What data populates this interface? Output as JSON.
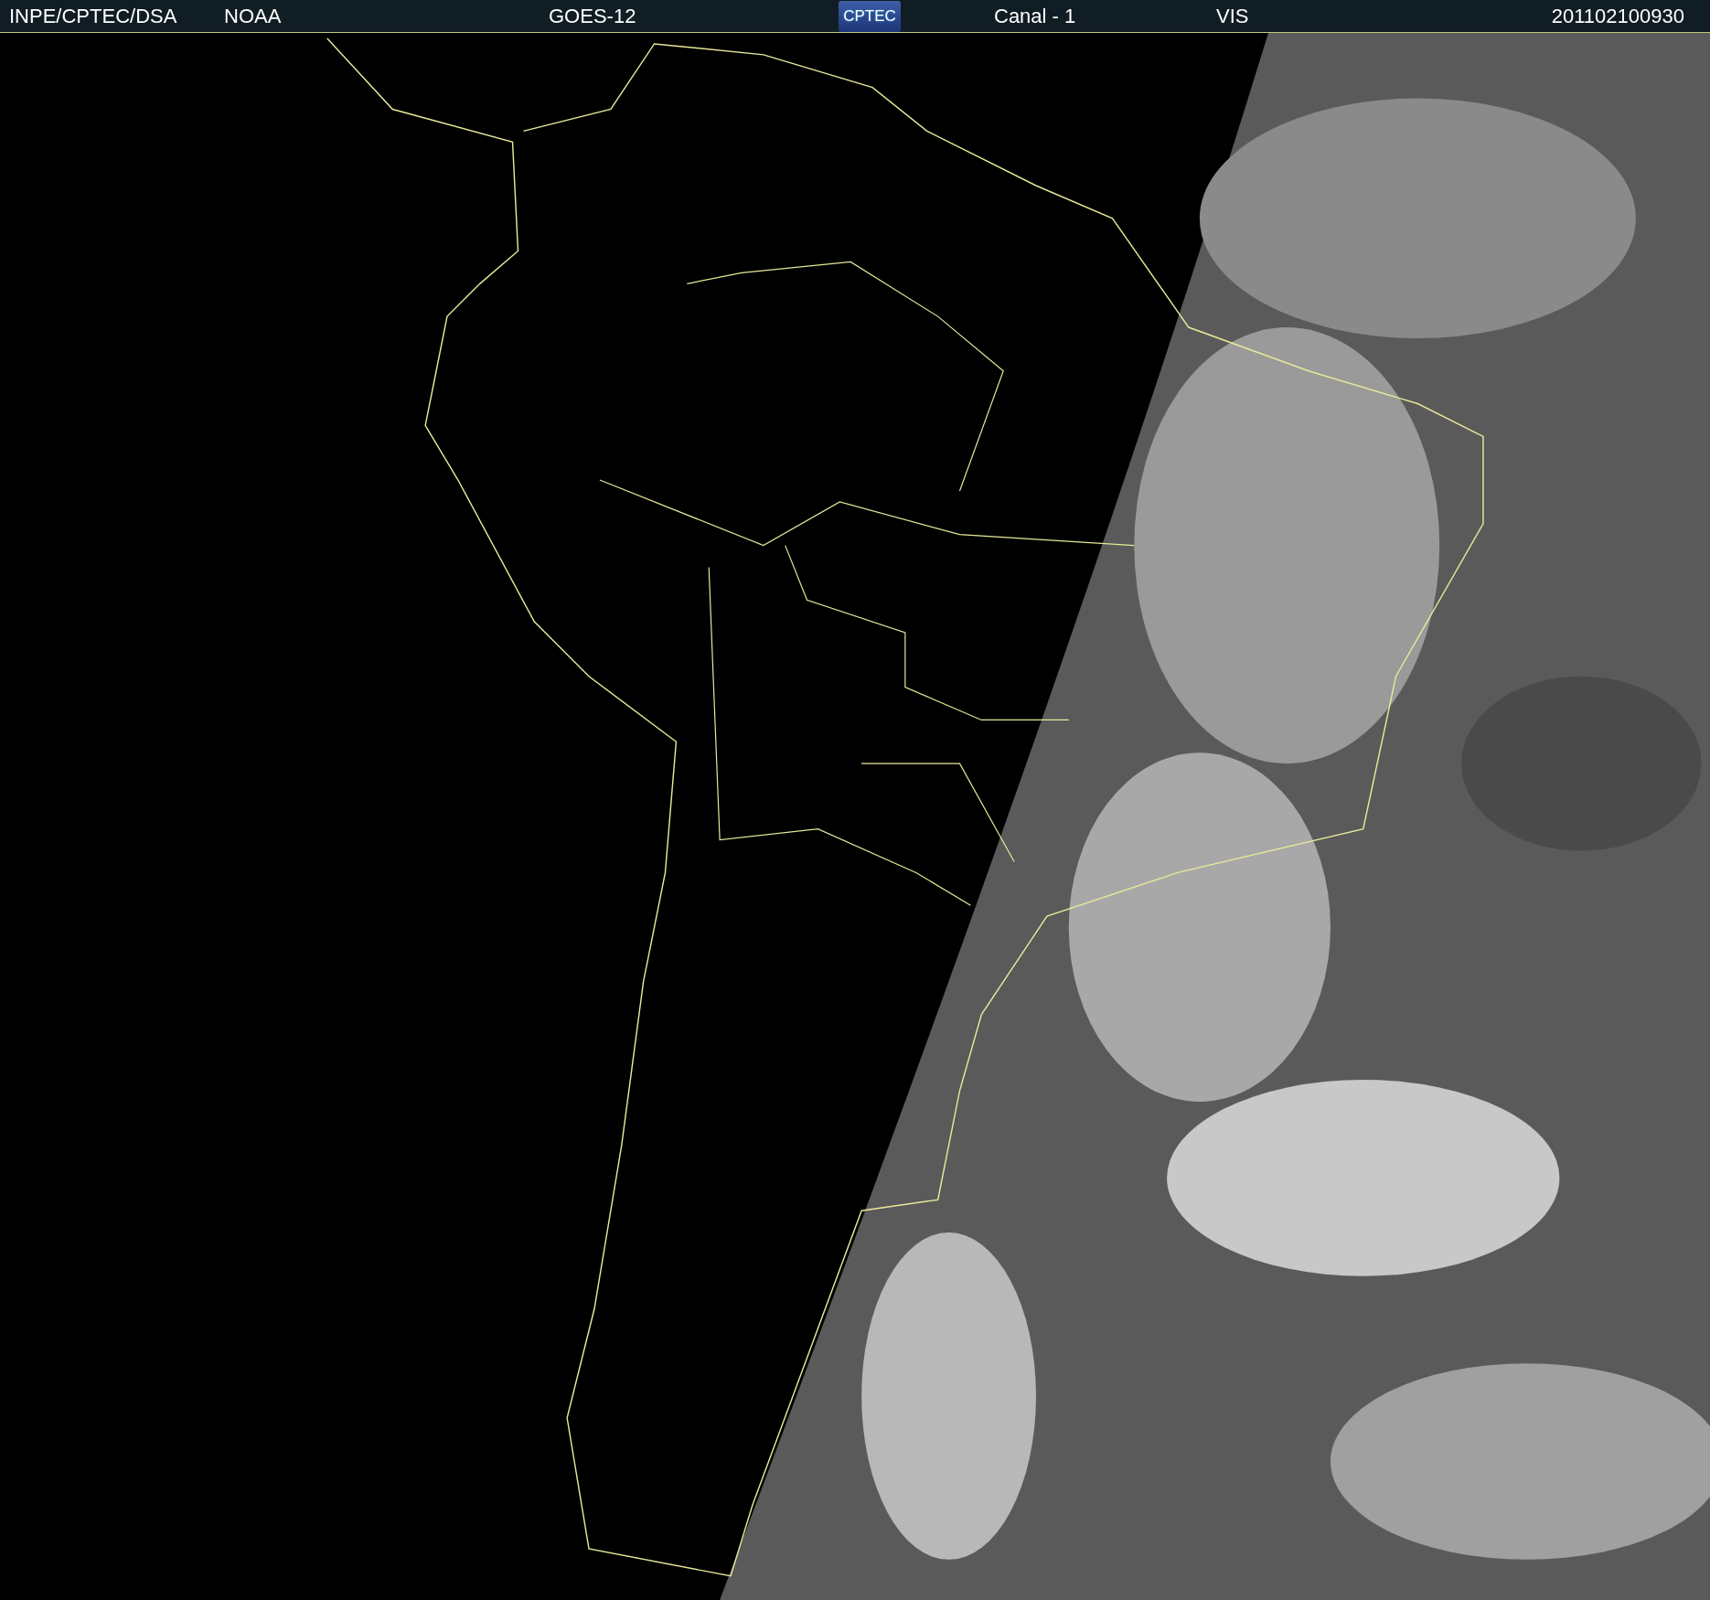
{
  "header": {
    "items": [
      {
        "kind": "text",
        "text": "INPE/CPTEC/DSA"
      },
      {
        "kind": "text",
        "text": "NOAA"
      },
      {
        "kind": "text",
        "text": "GOES-12"
      },
      {
        "kind": "logo",
        "text": "CPTEC"
      },
      {
        "kind": "text",
        "text": "Canal - 1"
      },
      {
        "kind": "text",
        "text": "VIS"
      },
      {
        "kind": "text",
        "text": "201102100930"
      }
    ]
  }
}
